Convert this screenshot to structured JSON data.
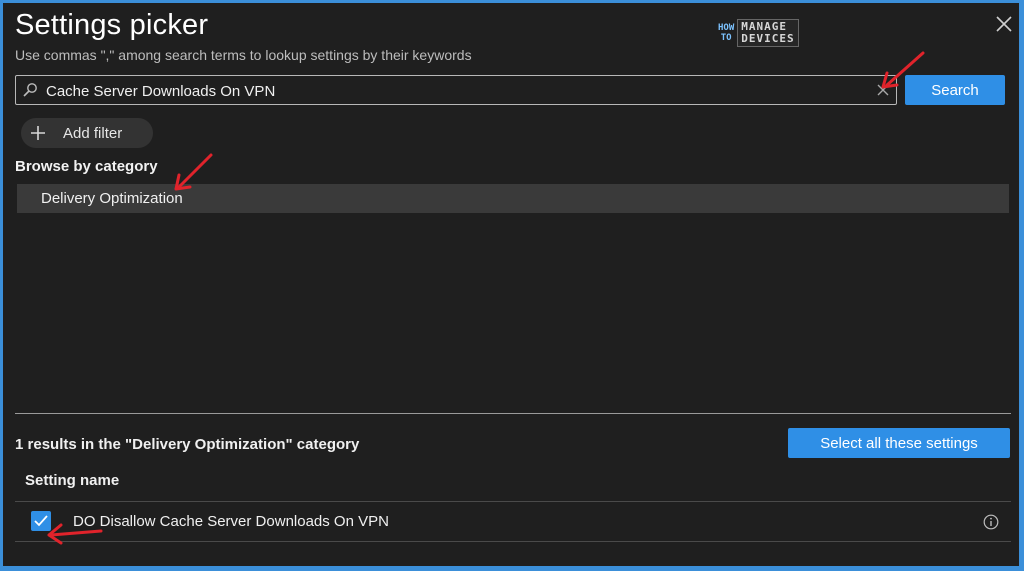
{
  "header": {
    "title": "Settings picker",
    "subtitle": "Use commas \",\" among search terms to lookup settings by their keywords"
  },
  "logo": {
    "how": "HOW",
    "to": "TO",
    "manage": "MANAGE",
    "devices": "DEVICES"
  },
  "search": {
    "value": "Cache Server Downloads On VPN",
    "button_label": "Search"
  },
  "filter": {
    "add_label": "Add filter"
  },
  "browse": {
    "heading": "Browse by category",
    "categories": [
      "Delivery Optimization"
    ]
  },
  "results": {
    "summary": "1 results in the \"Delivery Optimization\" category",
    "select_all_label": "Select all these settings",
    "column_header": "Setting name",
    "rows": [
      {
        "name": "DO Disallow Cache Server Downloads On VPN",
        "checked": true
      }
    ]
  },
  "colors": {
    "accent": "#2f8fe6",
    "background": "#1f1f1f",
    "annotation_arrow": "#e0232b"
  }
}
